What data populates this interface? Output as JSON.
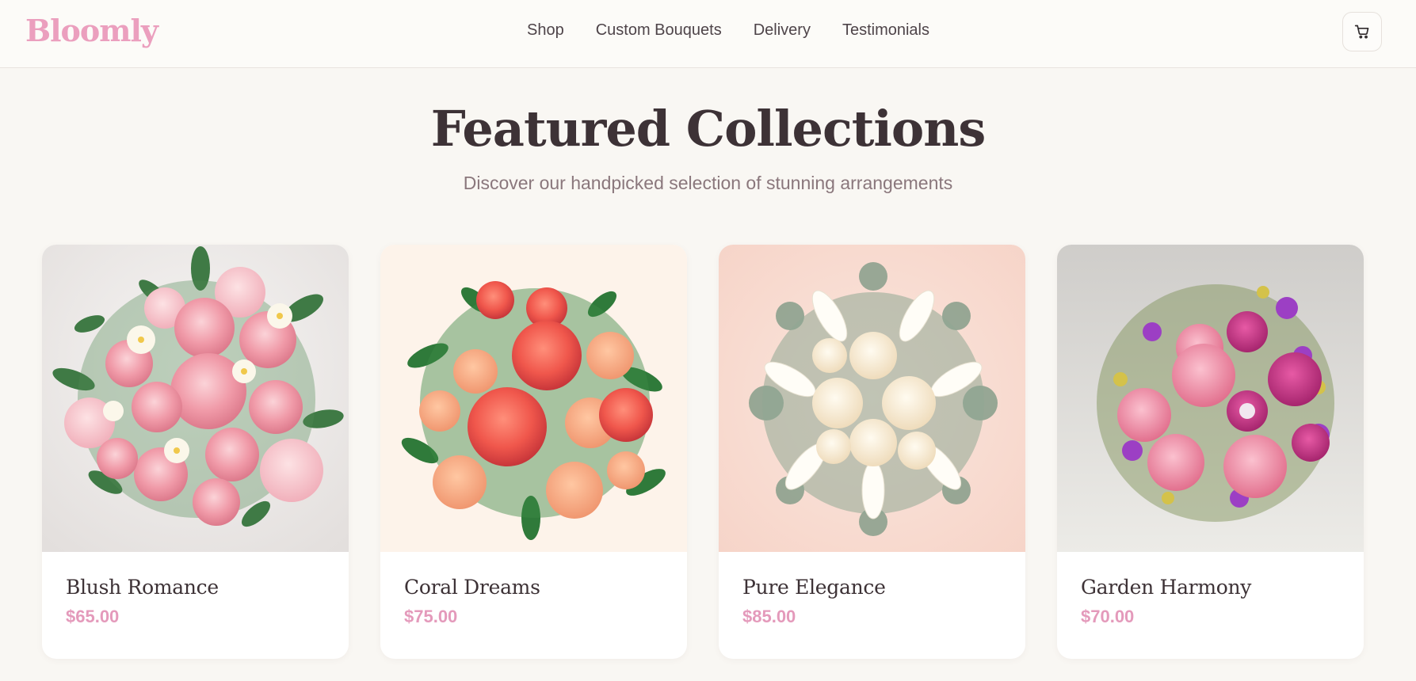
{
  "header": {
    "logo": "Bloomly",
    "nav": [
      "Shop",
      "Custom Bouquets",
      "Delivery",
      "Testimonials"
    ],
    "cart_icon": "shopping-cart-icon"
  },
  "hero": {
    "title": "Featured Collections",
    "subtitle": "Discover our handpicked selection of stunning arrangements"
  },
  "products": [
    {
      "name": "Blush Romance",
      "price": "$65.00",
      "image": "pink-rose-bouquet"
    },
    {
      "name": "Coral Dreams",
      "price": "$75.00",
      "image": "coral-rose-bouquet"
    },
    {
      "name": "Pure Elegance",
      "price": "$85.00",
      "image": "white-lily-rose-bouquet"
    },
    {
      "name": "Garden Harmony",
      "price": "$70.00",
      "image": "mixed-pink-purple-bouquet"
    }
  ],
  "colors": {
    "accent": "#eb9fbe",
    "price": "#e49abb",
    "background": "#f9f7f3",
    "text": "#3d3236"
  }
}
